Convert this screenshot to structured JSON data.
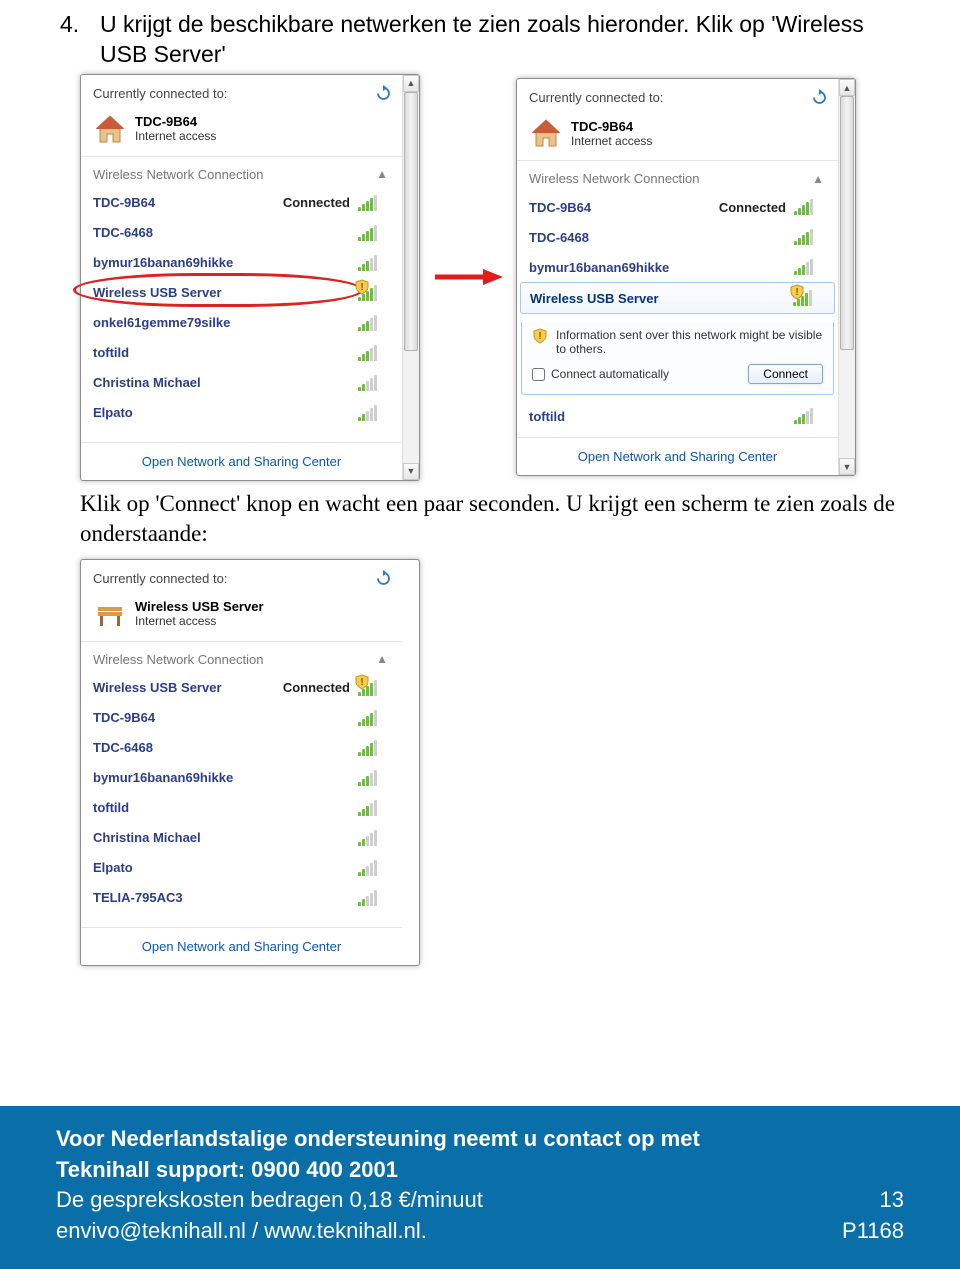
{
  "step": {
    "num": "4.",
    "text1": "U krijgt de beschikbare netwerken te zien zoals hieronder. Klik op 'Wireless USB Server'"
  },
  "midtext": "Klik op 'Connect' knop en wacht een paar seconden. U krijgt een scherm te zien zoals de onderstaande:",
  "common": {
    "header": "Currently connected to:",
    "section": "Wireless Network Connection",
    "footer": "Open Network and Sharing Center",
    "status_connected": "Connected"
  },
  "panel1": {
    "conn": {
      "name": "TDC-9B64",
      "sub": "Internet access",
      "icon": "house"
    },
    "items": [
      {
        "name": "TDC-9B64",
        "status": "Connected",
        "strength": 4
      },
      {
        "name": "TDC-6468",
        "strength": 4
      },
      {
        "name": "bymur16banan69hikke",
        "strength": 3
      },
      {
        "name": "Wireless USB Server",
        "strength": 4,
        "warn": true,
        "circle": true
      },
      {
        "name": "onkel61gemme79silke",
        "strength": 3
      },
      {
        "name": "toftild",
        "strength": 3
      },
      {
        "name": "Christina Michael",
        "strength": 2
      },
      {
        "name": "Elpato",
        "strength": 2
      }
    ]
  },
  "panel2": {
    "conn": {
      "name": "TDC-9B64",
      "sub": "Internet access",
      "icon": "house"
    },
    "items": [
      {
        "name": "TDC-9B64",
        "status": "Connected",
        "strength": 4
      },
      {
        "name": "TDC-6468",
        "strength": 4
      },
      {
        "name": "bymur16banan69hikke",
        "strength": 3
      },
      {
        "name": "Wireless USB Server",
        "strength": 4,
        "warn": true,
        "selected": true
      }
    ],
    "expand": {
      "info": "Information sent over this network might be visible to others.",
      "checkbox": "Connect automatically",
      "button": "Connect"
    },
    "tail": [
      {
        "name": "toftild",
        "strength": 3
      }
    ]
  },
  "panel3": {
    "conn": {
      "name": "Wireless USB Server",
      "sub": "Internet access",
      "icon": "bench"
    },
    "items": [
      {
        "name": "Wireless USB Server",
        "status": "Connected",
        "strength": 4,
        "warn": true,
        "bold": true
      },
      {
        "name": "TDC-9B64",
        "strength": 4
      },
      {
        "name": "TDC-6468",
        "strength": 4
      },
      {
        "name": "bymur16banan69hikke",
        "strength": 3
      },
      {
        "name": "toftild",
        "strength": 3
      },
      {
        "name": "Christina Michael",
        "strength": 2
      },
      {
        "name": "Elpato",
        "strength": 2
      },
      {
        "name": "TELIA-795AC3",
        "strength": 2
      }
    ]
  },
  "footer": {
    "l1": "Voor Nederlandstalige ondersteuning neemt u contact op met",
    "l2": "Teknihall support: 0900 400 2001",
    "l3a": "De gesprekskosten bedragen 0,18 €/minuut",
    "l3b": "13",
    "l4a": "envivo@teknihall.nl / www.teknihall.nl.",
    "l4b": "P1168"
  }
}
